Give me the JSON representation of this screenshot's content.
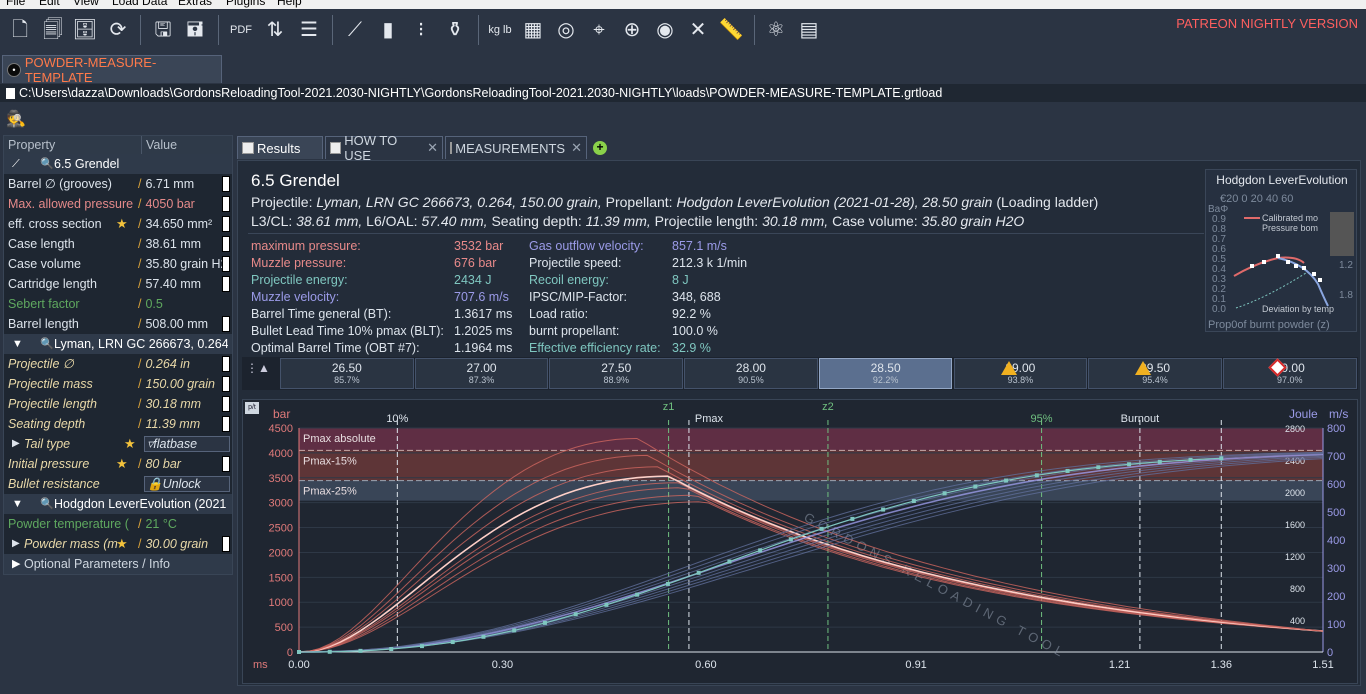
{
  "menu": {
    "items": [
      "File",
      "Edit",
      "View",
      "Load Data",
      "Extras",
      "Plugins",
      "Help"
    ]
  },
  "toolbar": {
    "icons": [
      "new-file-icon",
      "open-file-icon",
      "save-icon",
      "reload-icon",
      "save-as-icon",
      "save-copy-icon",
      "pdf-icon",
      "compare-icon",
      "report-icon",
      "rifle-icon",
      "cartridge-icon",
      "bullets-icon",
      "powder-icon",
      "unit-conversion-icon",
      "grid-icon",
      "barrel-icon",
      "telescope-icon",
      "target-icon",
      "obt-icon",
      "tools-icon",
      "measure-icon",
      "atom-icon",
      "calculator-icon"
    ],
    "patreon_label": "PATREON NIGHTLY VERSION"
  },
  "file_tab": {
    "label": "POWDER-MEASURE-TEMPLATE"
  },
  "path": "C:\\Users\\dazza\\Downloads\\GordonsReloadingTool-2021.2030-NIGHTLY\\GordonsReloadingTool-2021.2030-NIGHTLY\\loads\\POWDER-MEASURE-TEMPLATE.grtload",
  "properties": {
    "header": {
      "property": "Property",
      "value": "Value"
    },
    "cartridge_group": "6.5 Grendel",
    "barrel_groove": {
      "label": "Barrel ∅ (grooves)",
      "value": "6.71 mm"
    },
    "max_pressure": {
      "label": "Max. allowed pressure",
      "value": "4050 bar"
    },
    "cross_section": {
      "label": "eff. cross section",
      "value": "34.650 mm²"
    },
    "case_length": {
      "label": "Case length",
      "value": "38.61 mm"
    },
    "case_volume": {
      "label": "Case volume",
      "value": "35.80 grain H2O"
    },
    "cartridge_length": {
      "label": "Cartridge length",
      "value": "57.40 mm"
    },
    "sebert": {
      "label": "Sebert factor",
      "value": "0.5"
    },
    "barrel_length": {
      "label": "Barrel length",
      "value": "508.00 mm"
    },
    "projectile_group": "Lyman, LRN GC 266673, 0.264,",
    "projectile_dia": {
      "label": "Projectile ∅",
      "value": "0.264 in"
    },
    "projectile_mass": {
      "label": "Projectile mass",
      "value": "150.00 grain"
    },
    "projectile_length": {
      "label": "Projectile length",
      "value": "30.18 mm"
    },
    "seating_depth": {
      "label": "Seating depth",
      "value": "11.39 mm"
    },
    "tail_type": {
      "label": "Tail type",
      "value": "flatbase"
    },
    "initial_pressure": {
      "label": "Initial pressure",
      "value": "80 bar"
    },
    "bullet_resistance": {
      "label": "Bullet resistance",
      "value": "Unlock"
    },
    "powder_group": "Hodgdon LeverEvolution (2021",
    "powder_temp": {
      "label": "Powder temperature (",
      "value": "21 °C"
    },
    "powder_mass": {
      "label": "Powder mass (m",
      "value": "30.00 grain"
    },
    "optional": "Optional Parameters / Info"
  },
  "tabs": [
    {
      "label": "Results",
      "active": true
    },
    {
      "label": "HOW TO USE",
      "active": false
    },
    {
      "label": "MEASUREMENTS",
      "active": false
    }
  ],
  "results": {
    "title": "6.5 Grendel",
    "projectile_label": "Projectile:",
    "projectile": "Lyman, LRN GC 266673, 0.264, 150.00 grain,",
    "propellant_label": "Propellant:",
    "propellant": "Hodgdon LeverEvolution (2021-01-28), 28.50 grain",
    "ladder_note": "(Loading ladder)",
    "l3_label": "L3/CL:",
    "l3": "38.61 mm,",
    "l6_label": "L6/OAL:",
    "l6": "57.40 mm,",
    "seat_label": "Seating depth:",
    "seat": "11.39 mm,",
    "plen_label": "Projectile length:",
    "plen": "30.18 mm,",
    "cv_label": "Case volume:",
    "cv": "35.80 grain H2O",
    "stats": [
      {
        "k": "maximum pressure:",
        "v": "3532 bar",
        "c": "#e88a8a"
      },
      {
        "k": "Muzzle pressure:",
        "v": "676 bar",
        "c": "#e88a8a"
      },
      {
        "k": "Projectile energy:",
        "v": "2434 J",
        "c": "#7fc7c0"
      },
      {
        "k": "Muzzle velocity:",
        "v": "707.6 m/s",
        "c": "#9b9be8"
      },
      {
        "k": "Barrel Time general (BT):",
        "v": "1.3617 ms",
        "c": "#dde4ec"
      },
      {
        "k": "Bullet Lead Time 10% pmax (BLT):",
        "v": "1.2025 ms",
        "c": "#dde4ec"
      },
      {
        "k": "Optimal Barrel Time (OBT #7):",
        "v": "1.1964 ms",
        "c": "#dde4ec"
      }
    ],
    "stats2": [
      {
        "k": "Gas outflow velocity:",
        "v": "857.1 m/s",
        "c": "#9b9be8"
      },
      {
        "k": "Projectile speed:",
        "v": "212.3 k 1/min",
        "c": "#dde4ec"
      },
      {
        "k": "Recoil energy:",
        "v": "8 J",
        "c": "#7fc7c0"
      },
      {
        "k": "IPSC/MIP-Factor:",
        "v": "348, 688",
        "c": "#dde4ec"
      },
      {
        "k": "Load ratio:",
        "v": "92.2 %",
        "c": "#dde4ec"
      },
      {
        "k": "burnt propellant:",
        "v": "100.0 %",
        "c": "#dde4ec"
      },
      {
        "k": "Effective efficiency rate:",
        "v": "32.9 %",
        "c": "#7fc7c0"
      }
    ]
  },
  "mini_chart": {
    "title": "Hodgdon LeverEvolution",
    "y_label": "BaΦ",
    "x_label": "Prop0of burnt powder (z)",
    "top_ticks": "€20 0 20 40 60",
    "legend1": "Calibrated mo",
    "legend2": "Pressure bom",
    "legend3": "Deviation by temp",
    "yticks": [
      "0.9",
      "0.8",
      "0.7",
      "0.6",
      "0.5",
      "0.4",
      "0.3",
      "0.2",
      "0.1",
      "0.0"
    ],
    "right_tick": "1.8",
    "right_tick2": "1.2"
  },
  "ladder": [
    {
      "a": "26.50",
      "b": "85.7%",
      "flag": ""
    },
    {
      "a": "27.00",
      "b": "87.3%",
      "flag": ""
    },
    {
      "a": "27.50",
      "b": "88.9%",
      "flag": ""
    },
    {
      "a": "28.00",
      "b": "90.5%",
      "flag": ""
    },
    {
      "a": "28.50",
      "b": "92.2%",
      "flag": "selected"
    },
    {
      "a": "29.00",
      "b": "93.8%",
      "flag": "warn"
    },
    {
      "a": "29.50",
      "b": "95.4%",
      "flag": "warn"
    },
    {
      "a": "30.00",
      "b": "97.0%",
      "flag": "danger"
    }
  ],
  "chart_data": {
    "type": "line",
    "xlabel": "ms",
    "ylabel_left": "bar",
    "ylabel_right1": "Joule",
    "ylabel_right2": "m/s",
    "xticks": [
      "0.00",
      "0.30",
      "0.60",
      "0.91",
      "1.21",
      "1.36",
      "1.51"
    ],
    "xlim": [
      0,
      1.51
    ],
    "yticks_left": [
      "4500",
      "4000",
      "3500",
      "3000",
      "2500",
      "2000",
      "1500",
      "1000",
      "500",
      "0"
    ],
    "ylim_left": [
      0,
      4500
    ],
    "yticks_joule": [
      "2800",
      "2400",
      "2000",
      "1600",
      "1200",
      "800",
      "400"
    ],
    "yticks_ms": [
      "800",
      "700",
      "600",
      "500",
      "400",
      "300",
      "200",
      "100",
      "0"
    ],
    "bands": [
      {
        "label": "Pmax absolute",
        "from": 4050,
        "to": 4500
      },
      {
        "label": "Pmax-15%",
        "from": 3442,
        "to": 4050
      },
      {
        "label": "Pmax-25%",
        "from": 3040,
        "to": 3442
      }
    ],
    "markers": [
      {
        "label": "10%",
        "x": 0.145
      },
      {
        "label": "z1",
        "x": 0.545
      },
      {
        "label": "Pmax",
        "x": 0.575
      },
      {
        "label": "z2",
        "x": 0.78
      },
      {
        "label": "95%",
        "x": 1.095
      },
      {
        "label": "Burnout",
        "x": 1.24
      },
      {
        "label": "",
        "x": 1.36
      }
    ],
    "pressure_series": [
      {
        "charge": 26.5,
        "peak": 3020,
        "t_peak": 0.6
      },
      {
        "charge": 27.0,
        "peak": 3150,
        "t_peak": 0.585
      },
      {
        "charge": 27.5,
        "peak": 3300,
        "t_peak": 0.57
      },
      {
        "charge": 28.0,
        "peak": 3400,
        "t_peak": 0.56
      },
      {
        "charge": 28.5,
        "peak": 3532,
        "t_peak": 0.545
      },
      {
        "charge": 29.0,
        "peak": 3720,
        "t_peak": 0.53
      },
      {
        "charge": 29.5,
        "peak": 3950,
        "t_peak": 0.515
      },
      {
        "charge": 30.0,
        "peak": 4290,
        "t_peak": 0.5
      }
    ],
    "velocity": {
      "x": [
        0,
        0.3,
        0.6,
        0.91,
        1.21,
        1.36
      ],
      "y": [
        0,
        60,
        330,
        530,
        650,
        707.6
      ],
      "unit": "m/s"
    },
    "watermark": "GORDONS RELOADING TOOL"
  }
}
